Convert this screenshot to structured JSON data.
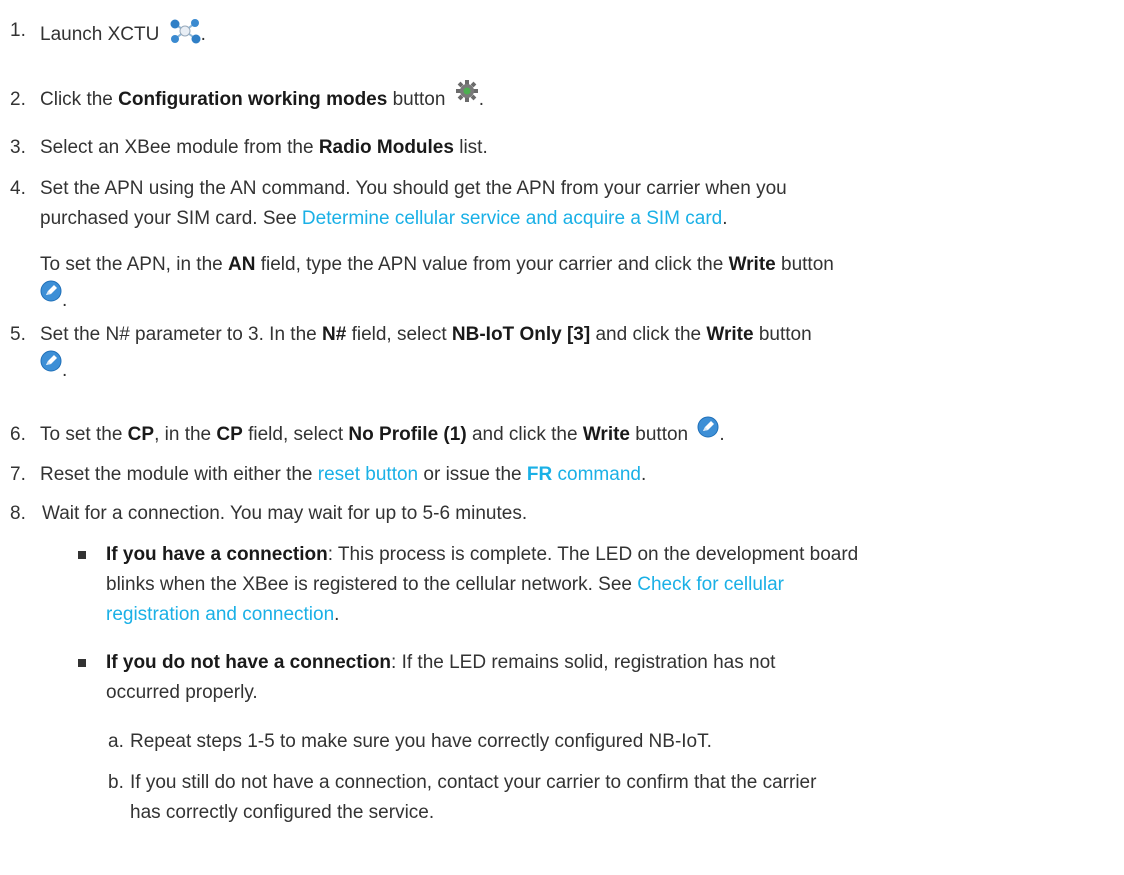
{
  "steps": [
    {
      "num": "1.",
      "pre": "Launch XCTU",
      "post": ".",
      "icon": "xctu-network-icon"
    },
    {
      "num": "2.",
      "pre": "Click the",
      "bold": "Configuration working modes",
      "mid": "button",
      "post": ".",
      "icon": "gear-icon"
    },
    {
      "num": "3.",
      "pre": "Select an XBee module from the",
      "bold": "Radio Modules",
      "post": "list."
    },
    {
      "num": "4.",
      "line1": "Set the APN using the AN command. You should get the APN from your carrier when you",
      "line2": "purchased your SIM card. See",
      "link": "Determine cellular service and acquire a SIM card",
      "post": ".",
      "para_pre": "To set the APN, in the",
      "para_bold1": "AN",
      "para_mid": "field, type the APN value from your carrier and click the",
      "para_bold2": "Write",
      "para_post": "button",
      "dot": ".",
      "icon": "write-icon"
    },
    {
      "num": "5.",
      "pre": "Set the N# parameter to 3. In the",
      "bold1": "N#",
      "mid": "field, select",
      "bold2": "NB-IoT Only [3]",
      "mid2": "and click the",
      "bold3": "Write",
      "post": "button",
      "dot": ".",
      "icon": "write-icon"
    },
    {
      "num": "6.",
      "pre": "To set the",
      "bold1": "CP",
      "mid1": ", in the",
      "bold2": "CP",
      "mid2": "field, select",
      "bold3": "No Profile (1)",
      "mid3": "and click the",
      "bold4": "Write",
      "post": "button",
      "dot": ".",
      "icon": "write-icon"
    },
    {
      "num": "7.",
      "pre": "Reset the module with either the",
      "link1": "reset button",
      "mid": "or issue the",
      "link2_bold": "FR",
      "link2": "command",
      "post": "."
    },
    {
      "num": "8.",
      "text": "Wait for a connection. You may wait for up to 5-6 minutes.",
      "bullet1_bold": "If you have a connection",
      "bullet1_line1": ": This process is complete. The LED on the development board",
      "bullet1_line2": "blinks when the XBee is registered to the cellular network. See",
      "bullet1_link_a": "Check for cellular",
      "bullet1_link_b": "registration and connection",
      "bullet1_post": ".",
      "bullet2_bold": "If you do not have a connection",
      "bullet2_line1": ": If the LED remains solid, registration has not",
      "bullet2_line2": "occurred properly.",
      "sub_a_label": "a.",
      "sub_a_text": "Repeat steps 1-5 to make sure you have correctly configured NB-IoT.",
      "sub_b_label": "b.",
      "sub_b_line1": "If you still do not have a connection, contact your carrier to confirm that the carrier",
      "sub_b_line2": "has correctly configured the service."
    }
  ]
}
